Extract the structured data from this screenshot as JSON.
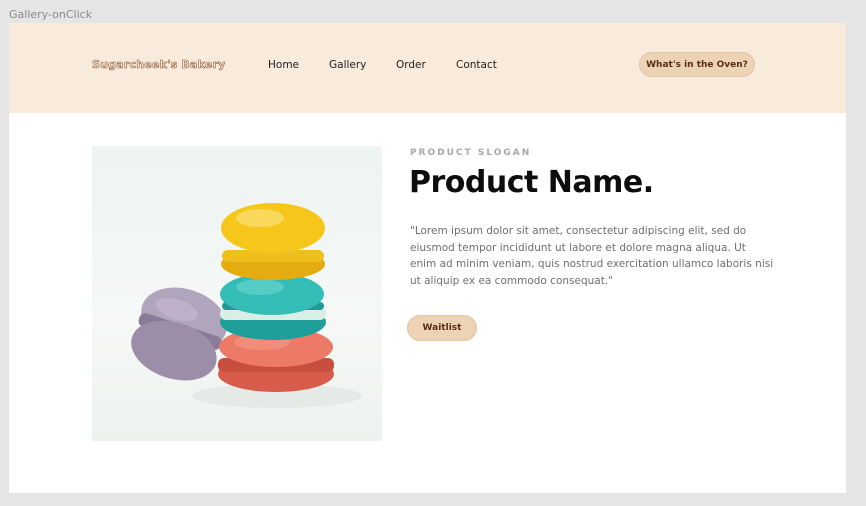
{
  "frame": {
    "label": "Gallery-onClick"
  },
  "header": {
    "logo": "Sugarcheek's Bakery",
    "nav": [
      "Home",
      "Gallery",
      "Order",
      "Contact"
    ],
    "cta": "What's in the Oven?"
  },
  "product": {
    "slogan": "PRODUCT SLOGAN",
    "name": "Product Name.",
    "description": "\"Lorem ipsum dolor sit amet, consectetur adipiscing elit, sed do eiusmod tempor incididunt ut labore et dolore magna aliqua. Ut enim ad minim veniam, quis nostrud exercitation ullamco laboris nisi ut aliquip ex ea commodo consequat.\"",
    "button": "Waitlist",
    "image_icon": "macarons-photo"
  },
  "colors": {
    "header_bg": "#f9ebdc",
    "button_bg": "#ecd3b6",
    "button_text": "#5a2d14",
    "macaron_yellow": "#f6c71a",
    "macaron_teal": "#2fb8b1",
    "macaron_coral": "#e8715f",
    "macaron_lavender": "#9c8ea8"
  }
}
